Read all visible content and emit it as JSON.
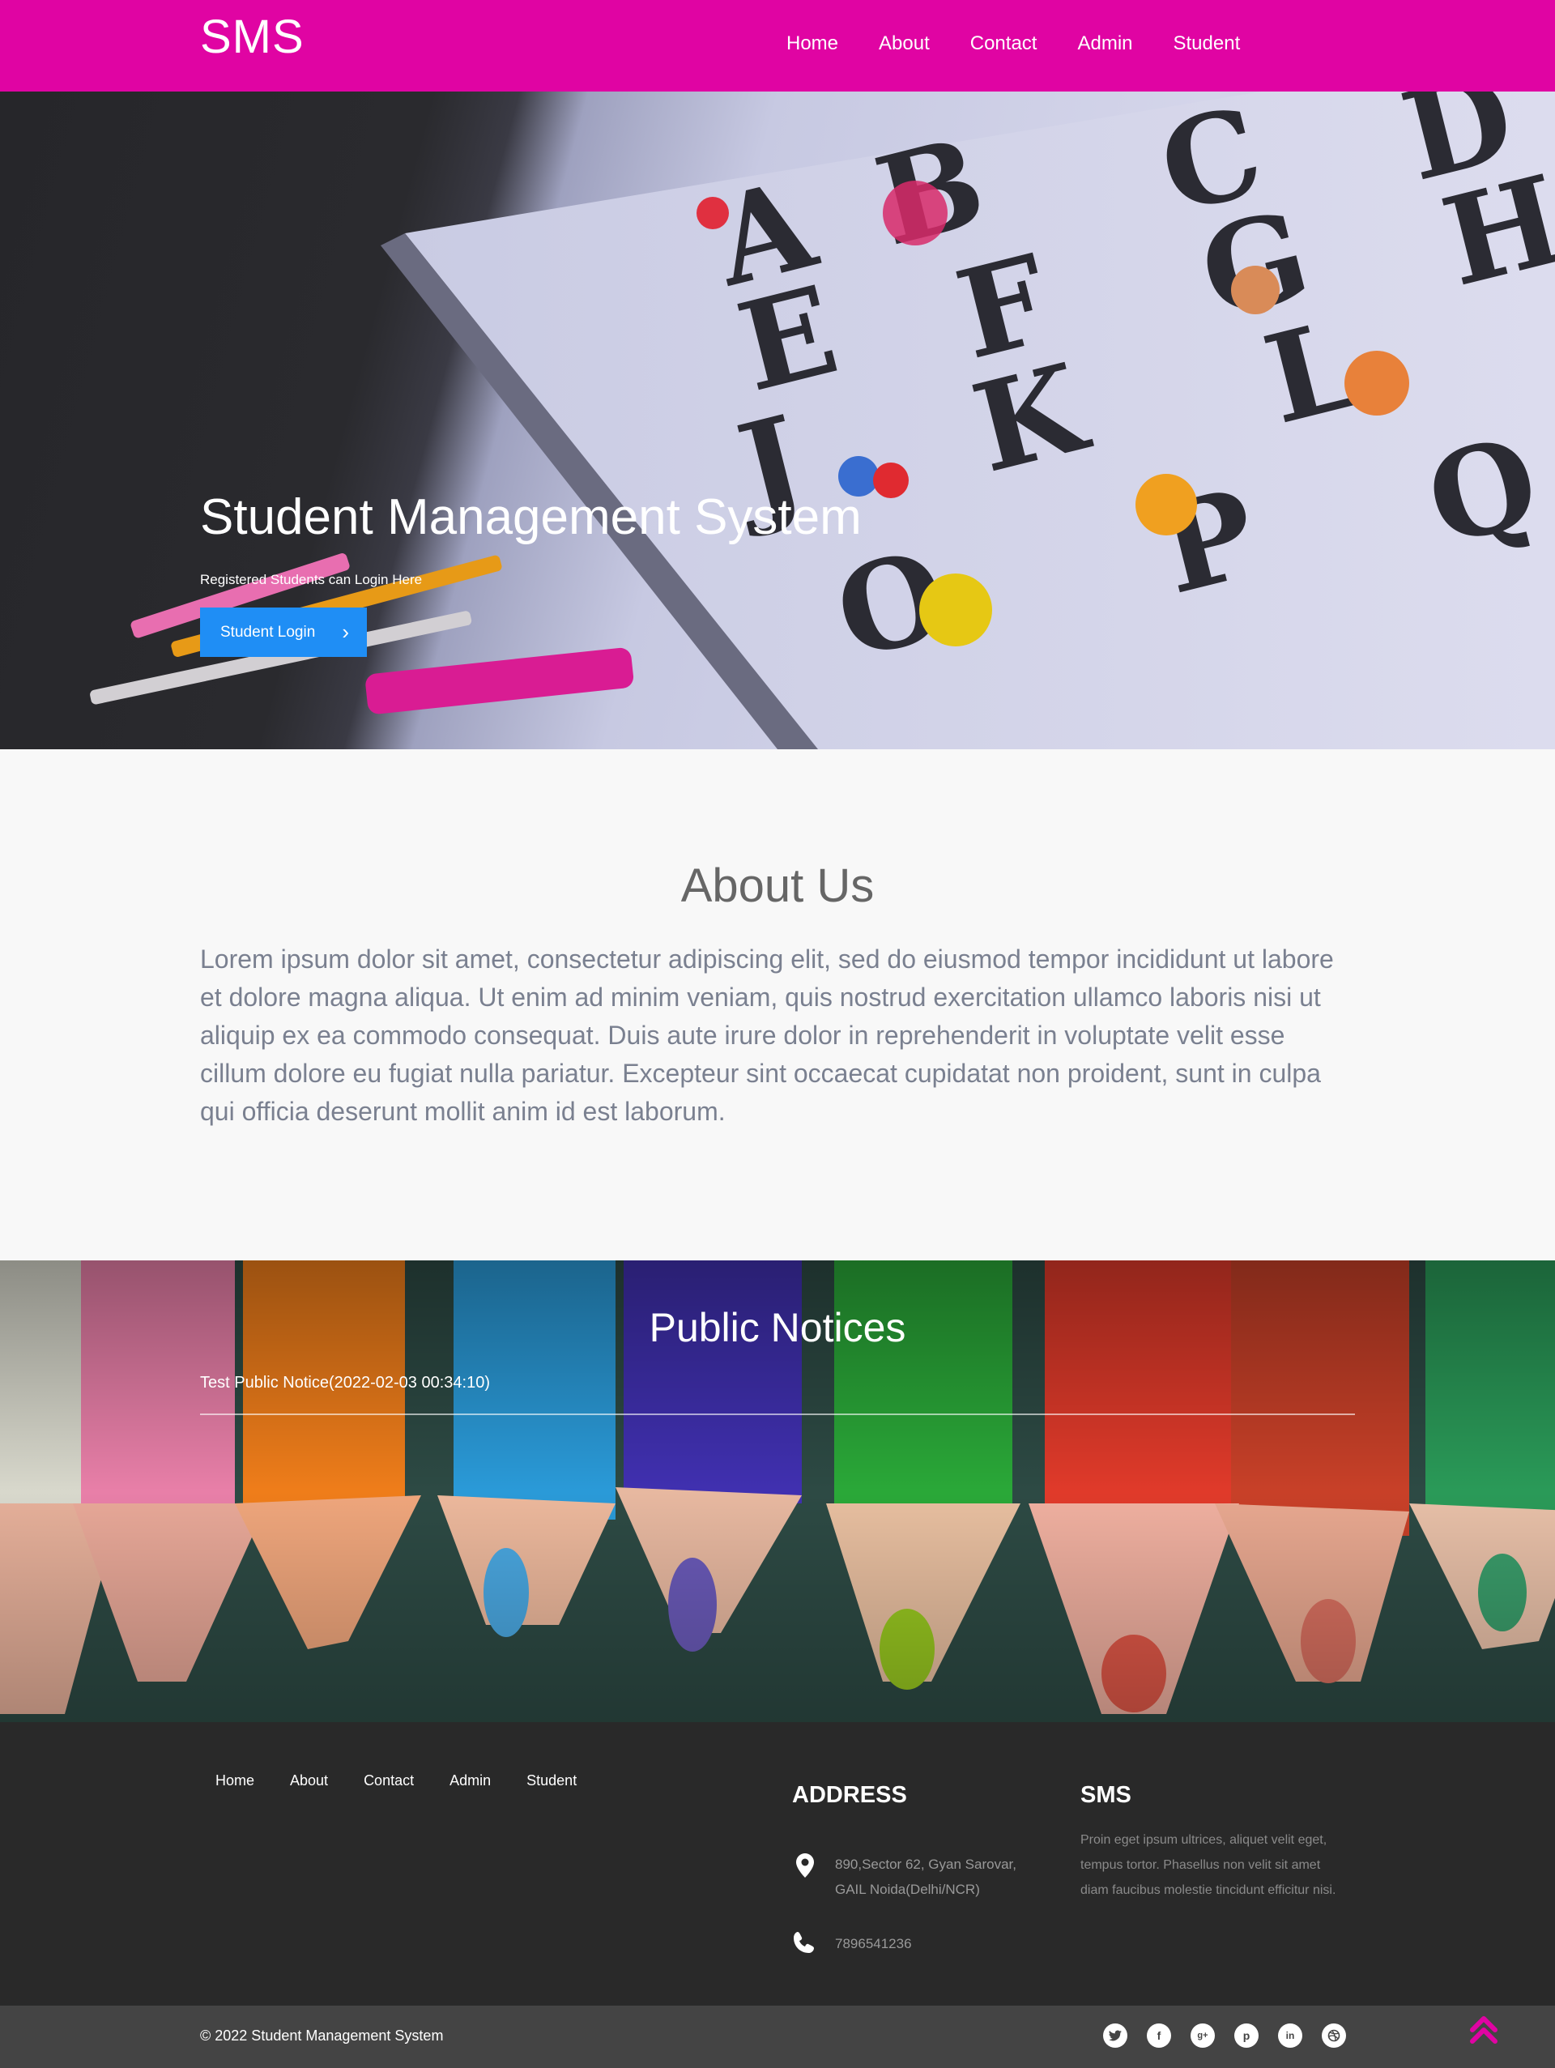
{
  "nav": {
    "brand": "SMS",
    "links": [
      "Home",
      "About",
      "Contact",
      "Admin",
      "Student"
    ]
  },
  "hero": {
    "title": "Student Management System",
    "subtitle": "Registered Students can Login Here",
    "button_label": "Student Login"
  },
  "about": {
    "title": "About Us",
    "text": "Lorem ipsum dolor sit amet, consectetur adipiscing elit, sed do eiusmod tempor incididunt ut labore et dolore magna aliqua. Ut enim ad minim veniam, quis nostrud exercitation ullamco laboris nisi ut aliquip ex ea commodo consequat. Duis aute irure dolor in reprehenderit in voluptate velit esse cillum dolore eu fugiat nulla pariatur. Excepteur sint occaecat cupidatat non proident, sunt in culpa qui officia deserunt mollit anim id est laborum."
  },
  "notices": {
    "title": "Public Notices",
    "items": [
      "Test Public Notice(2022-02-03 00:34:10)"
    ]
  },
  "footer": {
    "links": [
      "Home",
      "About",
      "Contact",
      "Admin",
      "Student"
    ],
    "address_title": "ADDRESS",
    "address_line1": "890,Sector 62, Gyan Sarovar,",
    "address_line2": "GAIL Noida(Delhi/NCR)",
    "phone": "7896541236",
    "sms_title": "SMS",
    "sms_text": "Proin eget ipsum ultrices, aliquet velit eget, tempus tortor. Phasellus non velit sit amet diam faucibus molestie tincidunt efficitur nisi."
  },
  "bottom": {
    "copyright": "© 2022 Student Management System",
    "socials": [
      "twitter-icon",
      "facebook-icon",
      "google-plus-icon",
      "pinterest-icon",
      "linkedin-icon",
      "dribbble-icon"
    ]
  },
  "colors": {
    "brand": "#e004a3",
    "button": "#1f8ef5",
    "footer": "#292929",
    "bottom_bar": "#444444"
  }
}
